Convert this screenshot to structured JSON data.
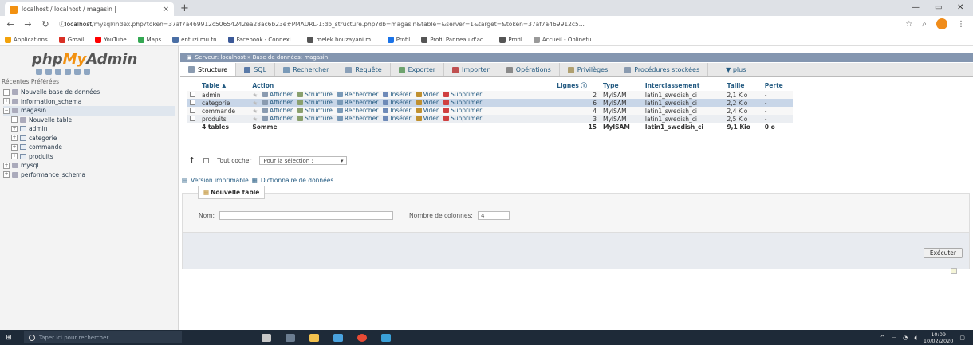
{
  "browser": {
    "tab_title": "localhost / localhost / magasin |",
    "tab_close": "×",
    "new_tab": "+",
    "url_prefix": "ⓘ ",
    "url_host": "localhost",
    "url_rest": "/mysql/index.php?token=37af7a469912c50654242ea28ac6b23e#PMAURL-1:db_structure.php?db=magasin&table=&server=1&target=&token=37af7a469912c5...",
    "win_min": "—",
    "win_max": "▭",
    "win_close": "✕",
    "bookmarks": [
      {
        "label": "Applications",
        "color": "#f2a20c"
      },
      {
        "label": "Gmail",
        "color": "#d93025"
      },
      {
        "label": "YouTube",
        "color": "#ff0000"
      },
      {
        "label": "Maps",
        "color": "#34a853"
      },
      {
        "label": "entuzi.mu.tn",
        "color": "#4a6fa5"
      },
      {
        "label": "Facebook - Connexi...",
        "color": "#3b5998"
      },
      {
        "label": "melek.bouzayani m...",
        "color": "#555555"
      },
      {
        "label": "Profil",
        "color": "#1a73e8"
      },
      {
        "label": "Profil Panneau d'ac...",
        "color": "#555555"
      },
      {
        "label": "Profil",
        "color": "#555555"
      },
      {
        "label": "Accueil - Onlinetu",
        "color": "#999999"
      }
    ]
  },
  "nav": {
    "logo_php": "php",
    "logo_my": "My",
    "logo_admin": "Admin",
    "tabs": "Récentes   Préférées",
    "tree": [
      {
        "label": "Nouvelle base de données",
        "level": 0,
        "kind": "new"
      },
      {
        "label": "information_schema",
        "level": 0,
        "kind": "db"
      },
      {
        "label": "magasin",
        "level": 0,
        "kind": "db",
        "selected": true
      },
      {
        "label": "Nouvelle table",
        "level": 1,
        "kind": "new"
      },
      {
        "label": "admin",
        "level": 1,
        "kind": "table"
      },
      {
        "label": "categorie",
        "level": 1,
        "kind": "table"
      },
      {
        "label": "commande",
        "level": 1,
        "kind": "table"
      },
      {
        "label": "produits",
        "level": 1,
        "kind": "table"
      },
      {
        "label": "mysql",
        "level": 0,
        "kind": "db"
      },
      {
        "label": "performance_schema",
        "level": 0,
        "kind": "db"
      }
    ]
  },
  "main": {
    "breadcrumb": "Serveur: localhost » Base de données: magasin",
    "tabs": [
      {
        "label": "Structure",
        "color": "#8a9bb0",
        "active": true
      },
      {
        "label": "SQL",
        "color": "#5a7aa8"
      },
      {
        "label": "Rechercher",
        "color": "#7a9ab8"
      },
      {
        "label": "Requête",
        "color": "#8aa0b8"
      },
      {
        "label": "Exporter",
        "color": "#6ea36e"
      },
      {
        "label": "Importer",
        "color": "#c05050"
      },
      {
        "label": "Opérations",
        "color": "#8a8a8a"
      },
      {
        "label": "Privilèges",
        "color": "#b0a070"
      },
      {
        "label": "Procédures stockées",
        "color": "#8a9bb0"
      },
      {
        "label": "▼ plus",
        "color": "#e8e8e8"
      }
    ],
    "table": {
      "headers": {
        "table": "Table ▲",
        "action": "Action",
        "rows": "Lignes ⓘ",
        "type": "Type",
        "collation": "Interclassement",
        "size": "Taille",
        "overhead": "Perte"
      },
      "actions": [
        "Afficher",
        "Structure",
        "Rechercher",
        "Insérer",
        "Vider",
        "Supprimer"
      ],
      "rows": [
        {
          "name": "admin",
          "rows": "2",
          "type": "MyISAM",
          "collation": "latin1_swedish_ci",
          "size": "2,1 Kio",
          "overhead": "-"
        },
        {
          "name": "categorie",
          "rows": "6",
          "type": "MyISAM",
          "collation": "latin1_swedish_ci",
          "size": "2,2 Kio",
          "overhead": "-"
        },
        {
          "name": "commande",
          "rows": "4",
          "type": "MyISAM",
          "collation": "latin1_swedish_ci",
          "size": "2,4 Kio",
          "overhead": "-"
        },
        {
          "name": "produits",
          "rows": "3",
          "type": "MyISAM",
          "collation": "latin1_swedish_ci",
          "size": "2,5 Kio",
          "overhead": "-"
        }
      ],
      "sum": {
        "name": "4 tables",
        "label": "Somme",
        "rows": "15",
        "type": "MyISAM",
        "collation": "latin1_swedish_ci",
        "size": "9,1 Kio",
        "overhead": "0 o"
      }
    },
    "select_all": "Tout cocher",
    "with_selected": "Pour la sélection :",
    "print_view": "Version imprimable",
    "data_dict": "Dictionnaire de données",
    "new_table": {
      "legend": "Nouvelle table",
      "name_label": "Nom:",
      "cols_label": "Nombre de colonnes:",
      "cols_value": "4",
      "execute": "Exécuter"
    }
  },
  "taskbar": {
    "search_placeholder": "Taper ici pour rechercher",
    "time": "10:09",
    "date": "10/02/2020"
  }
}
